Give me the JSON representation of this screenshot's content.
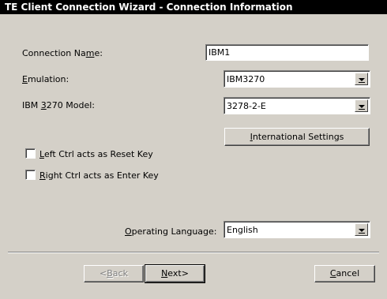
{
  "window": {
    "title": "TE Client Connection Wizard - Connection Information"
  },
  "connection_name": {
    "label_pre": "Connection Na",
    "label_key": "m",
    "label_post": "e:",
    "value": "IBM1"
  },
  "emulation": {
    "label_pre": "",
    "label_key": "E",
    "label_post": "mulation:",
    "value": "IBM3270"
  },
  "model": {
    "label_pre": "IBM ",
    "label_key": "3",
    "label_post": "270 Model:",
    "value": "3278-2-E"
  },
  "international_button": {
    "pre": "",
    "key": "I",
    "post": "nternational Settings"
  },
  "left_ctrl": {
    "pre": "",
    "key": "L",
    "post": "eft Ctrl acts as Reset Key",
    "checked": false
  },
  "right_ctrl": {
    "pre": "",
    "key": "R",
    "post": "ight Ctrl acts as Enter Key",
    "checked": false
  },
  "operating_language": {
    "label_pre": "",
    "label_key": "O",
    "label_post": "perating Language:",
    "value": "English"
  },
  "buttons": {
    "back": {
      "pre": "<",
      "key": "B",
      "post": "ack",
      "enabled": false
    },
    "next": {
      "pre": "",
      "key": "N",
      "post": "ext>",
      "enabled": true
    },
    "cancel": {
      "pre": "",
      "key": "C",
      "post": "ancel",
      "enabled": true
    }
  }
}
